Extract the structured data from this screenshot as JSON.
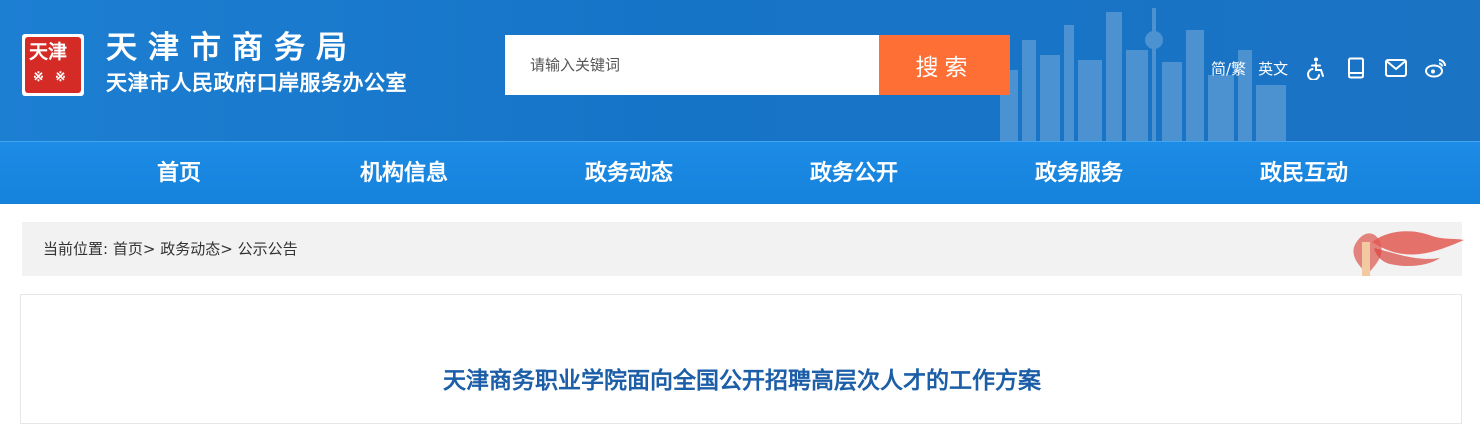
{
  "header": {
    "logo_text": "天津",
    "title": "天津市商务局",
    "subtitle": "天津市人民政府口岸服务办公室",
    "search": {
      "placeholder": "请输入关键词",
      "button_label": "搜索"
    },
    "tools": [
      {
        "label": "简/繁"
      },
      {
        "label": "英文"
      },
      {
        "icon": "accessibility-icon"
      },
      {
        "icon": "book-icon"
      },
      {
        "icon": "mail-icon"
      },
      {
        "icon": "weibo-icon"
      }
    ]
  },
  "nav": {
    "items": [
      {
        "label": "首页"
      },
      {
        "label": "机构信息"
      },
      {
        "label": "政务动态"
      },
      {
        "label": "政务公开"
      },
      {
        "label": "政务服务"
      },
      {
        "label": "政民互动"
      }
    ]
  },
  "breadcrumb": {
    "prefix": "当前位置:",
    "items": [
      "首页",
      "政务动态",
      "公示公告"
    ],
    "separator": ">"
  },
  "article": {
    "title": "天津商务职业学院面向全国公开招聘高层次人才的工作方案"
  },
  "colors": {
    "header_blue": "#1674c7",
    "nav_blue": "#1582db",
    "search_orange": "#fd6f35",
    "title_blue": "#1c5ea8"
  }
}
